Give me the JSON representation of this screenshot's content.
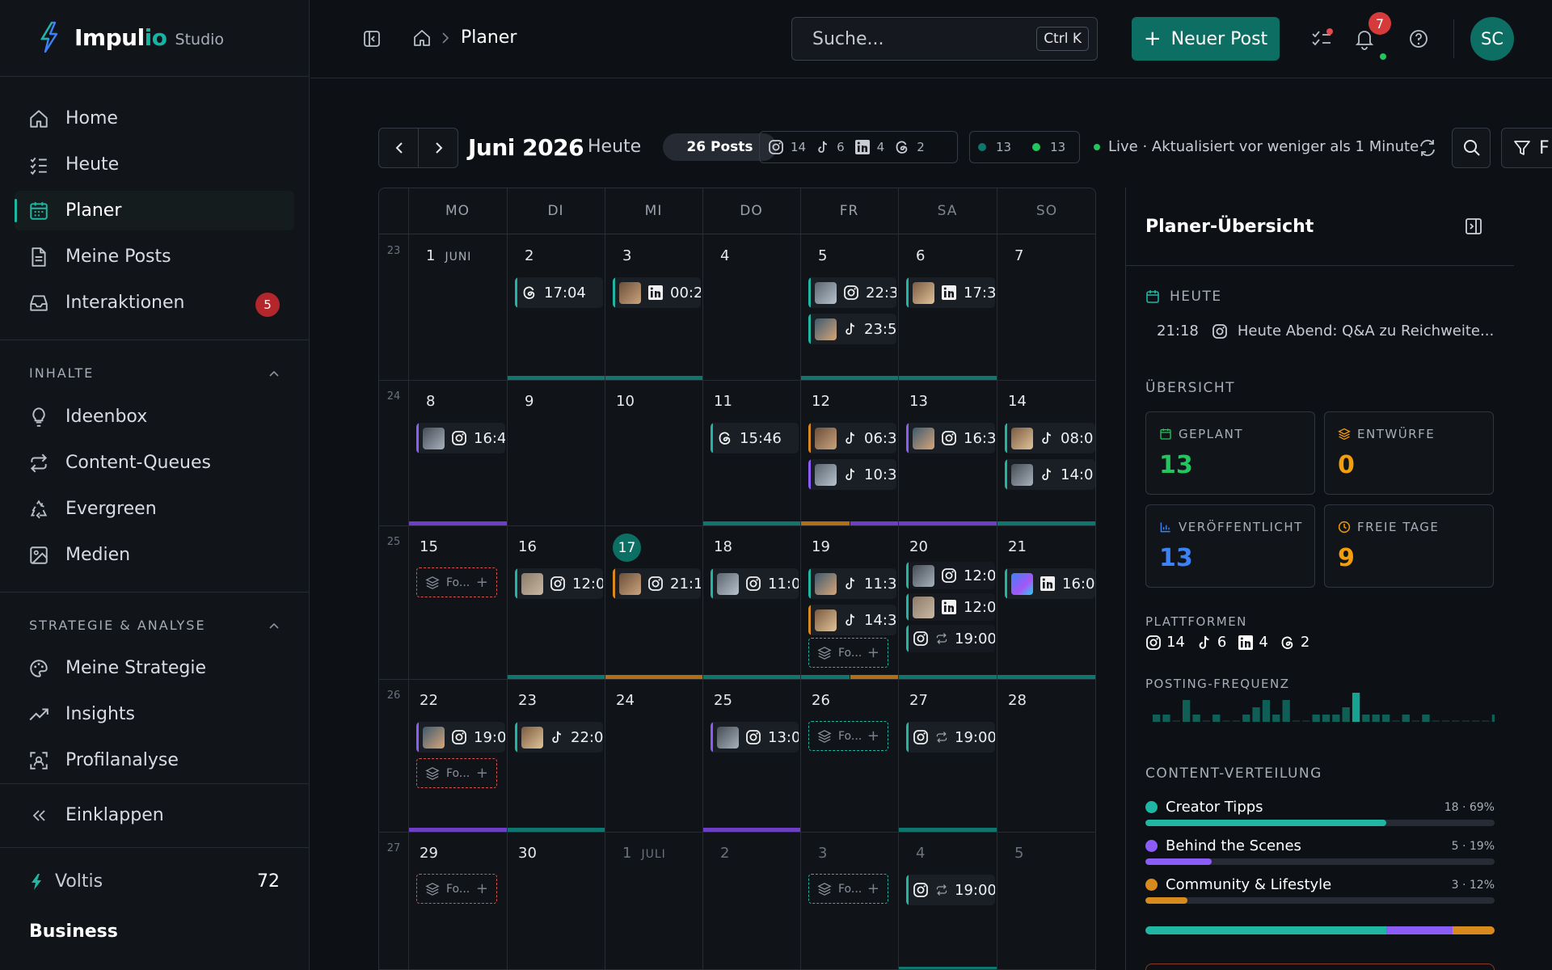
{
  "brand": {
    "name": "Impul",
    "name_accent": "io",
    "sub": "Studio"
  },
  "nav": {
    "items": [
      {
        "label": "Home",
        "icon": "home-icon"
      },
      {
        "label": "Heute",
        "icon": "checklist-icon"
      },
      {
        "label": "Planer",
        "icon": "calendar-icon",
        "active": true
      },
      {
        "label": "Meine Posts",
        "icon": "document-icon"
      },
      {
        "label": "Interaktionen",
        "icon": "inbox-icon",
        "badge": "5"
      }
    ],
    "section_content": "INHALTE",
    "content_items": [
      {
        "label": "Ideenbox",
        "icon": "lightbulb-icon"
      },
      {
        "label": "Content-Queues",
        "icon": "repeat-icon"
      },
      {
        "label": "Evergreen",
        "icon": "recycle-icon"
      },
      {
        "label": "Medien",
        "icon": "image-icon"
      }
    ],
    "section_strategy": "STRATEGIE & ANALYSE",
    "strategy_items": [
      {
        "label": "Meine Strategie",
        "icon": "palette-icon"
      },
      {
        "label": "Insights",
        "icon": "trend-icon"
      },
      {
        "label": "Profilanalyse",
        "icon": "scan-icon"
      }
    ],
    "collapse": "Einklappen",
    "voltis_label": "Voltis",
    "voltis_value": "72",
    "plan": "Business"
  },
  "topbar": {
    "breadcrumb": "Planer",
    "search_placeholder": "Suche...",
    "shortcut": "Ctrl K",
    "new_post": "Neuer Post",
    "notifications": "7",
    "avatar": "SC"
  },
  "toolbar": {
    "month": "Juni 2026",
    "today": "Heute",
    "posts": "26 Posts",
    "platform_counts": {
      "instagram": "14",
      "tiktok": "6",
      "linkedin": "4",
      "threads": "2"
    },
    "status_counts": {
      "scheduled": "13",
      "published": "13"
    },
    "live": "Live · Aktualisiert vor weniger als 1 Minute",
    "filter": "F"
  },
  "calendar": {
    "weekdays": [
      "MO",
      "DI",
      "MI",
      "DO",
      "FR",
      "SA",
      "SO"
    ],
    "week_numbers": [
      "23",
      "24",
      "25",
      "26",
      "27"
    ],
    "month_label_jun": "JUNI",
    "month_label_jul": "JULI",
    "today": "17",
    "days": [
      [
        "1",
        "2",
        "3",
        "4",
        "5",
        "6",
        "7"
      ],
      [
        "8",
        "9",
        "10",
        "11",
        "12",
        "13",
        "14"
      ],
      [
        "15",
        "16",
        "17",
        "18",
        "19",
        "20",
        "21"
      ],
      [
        "22",
        "23",
        "24",
        "25",
        "26",
        "27",
        "28"
      ],
      [
        "29",
        "30",
        "1",
        "2",
        "3",
        "4",
        "5"
      ]
    ],
    "posts": [
      {
        "w": 0,
        "d": 1,
        "slot": 0,
        "platform": "threads",
        "time": "17:04",
        "thumb": false,
        "bar": "#1fb6a4"
      },
      {
        "w": 0,
        "d": 2,
        "slot": 0,
        "platform": "linkedin",
        "time": "00:2",
        "thumb": true,
        "bar": "#1fb6a4"
      },
      {
        "w": 0,
        "d": 4,
        "slot": 0,
        "platform": "instagram",
        "time": "22:3",
        "thumb": true,
        "bar": "#1fb6a4"
      },
      {
        "w": 0,
        "d": 4,
        "slot": 1,
        "platform": "tiktok",
        "time": "23:5",
        "thumb": true,
        "bar": "#1fb6a4"
      },
      {
        "w": 0,
        "d": 5,
        "slot": 0,
        "platform": "linkedin",
        "time": "17:3",
        "thumb": true,
        "bar": "#1fb6a4"
      },
      {
        "w": 1,
        "d": 0,
        "slot": 0,
        "platform": "instagram",
        "time": "16:4",
        "thumb": true,
        "bar": "#8b5cf6"
      },
      {
        "w": 1,
        "d": 3,
        "slot": 0,
        "platform": "threads",
        "time": "15:46",
        "thumb": false,
        "bar": "#1fb6a4"
      },
      {
        "w": 1,
        "d": 4,
        "slot": 0,
        "platform": "tiktok",
        "time": "06:3",
        "thumb": true,
        "bar": "#d98a1e"
      },
      {
        "w": 1,
        "d": 4,
        "slot": 1,
        "platform": "tiktok",
        "time": "10:3",
        "thumb": true,
        "bar": "#8b5cf6"
      },
      {
        "w": 1,
        "d": 5,
        "slot": 0,
        "platform": "instagram",
        "time": "16:3",
        "thumb": true,
        "bar": "#8b5cf6"
      },
      {
        "w": 1,
        "d": 6,
        "slot": 0,
        "platform": "tiktok",
        "time": "08:0",
        "thumb": true,
        "bar": "#1fb6a4"
      },
      {
        "w": 1,
        "d": 6,
        "slot": 1,
        "platform": "tiktok",
        "time": "14:0",
        "thumb": true,
        "bar": "#1fb6a4"
      },
      {
        "w": 2,
        "d": 1,
        "slot": 0,
        "platform": "instagram",
        "time": "12:0",
        "thumb": true,
        "bar": "#1fb6a4"
      },
      {
        "w": 2,
        "d": 2,
        "slot": 0,
        "platform": "instagram",
        "time": "21:1",
        "thumb": true,
        "bar": "#d98a1e"
      },
      {
        "w": 2,
        "d": 3,
        "slot": 0,
        "platform": "instagram",
        "time": "11:0",
        "thumb": true,
        "bar": "#1fb6a4"
      },
      {
        "w": 2,
        "d": 4,
        "slot": 0,
        "platform": "tiktok",
        "time": "11:3",
        "thumb": true,
        "bar": "#1fb6a4"
      },
      {
        "w": 2,
        "d": 4,
        "slot": 1,
        "platform": "tiktok",
        "time": "14:3",
        "thumb": true,
        "bar": "#d98a1e"
      },
      {
        "w": 2,
        "d": 5,
        "slot": 0,
        "platform": "instagram",
        "time": "12:0",
        "thumb": true,
        "bar": "#1fb6a4",
        "compact": true
      },
      {
        "w": 2,
        "d": 5,
        "slot": 1,
        "platform": "linkedin",
        "time": "12:0",
        "thumb": true,
        "bar": "#1fb6a4",
        "compact": true
      },
      {
        "w": 2,
        "d": 5,
        "slot": 2,
        "platform": "instagram",
        "time": "19:00",
        "thumb": false,
        "repeat": true,
        "bar": "#1fb6a4",
        "compact": true
      },
      {
        "w": 2,
        "d": 6,
        "slot": 0,
        "platform": "linkedin",
        "time": "16:0",
        "thumb": true,
        "bar": "#1fb6a4",
        "thumbColor": "blue"
      },
      {
        "w": 3,
        "d": 0,
        "slot": 0,
        "platform": "instagram",
        "time": "19:0",
        "thumb": true,
        "bar": "#8b5cf6"
      },
      {
        "w": 3,
        "d": 1,
        "slot": 0,
        "platform": "tiktok",
        "time": "22:0",
        "thumb": true,
        "bar": "#1fb6a4"
      },
      {
        "w": 3,
        "d": 3,
        "slot": 0,
        "platform": "instagram",
        "time": "13:0",
        "thumb": true,
        "bar": "#8b5cf6"
      },
      {
        "w": 3,
        "d": 5,
        "slot": 0,
        "platform": "instagram",
        "time": "19:00",
        "thumb": false,
        "repeat": true,
        "bar": "#1fb6a4"
      },
      {
        "w": 4,
        "d": 5,
        "slot": 0,
        "platform": "instagram",
        "time": "19:00",
        "thumb": false,
        "repeat": true,
        "bar": "#1fb6a4"
      }
    ],
    "placeholders": [
      {
        "w": 2,
        "d": 0,
        "slot": 0,
        "label": "Fo...",
        "color": "#d9534f"
      },
      {
        "w": 2,
        "d": 4,
        "slot": 2,
        "label": "Fo...",
        "color": "#1fb6a4"
      },
      {
        "w": 3,
        "d": 0,
        "slot": 1,
        "label": "Fo...",
        "color": "#d9534f"
      },
      {
        "w": 3,
        "d": 4,
        "slot": 0,
        "label": "Fo...",
        "color": "#1fb6a4"
      },
      {
        "w": 4,
        "d": 0,
        "slot": 0,
        "label": "Fo...",
        "color": "#d9534f"
      },
      {
        "w": 4,
        "d": 4,
        "slot": 0,
        "label": "Fo...",
        "color": "#1fb6a4"
      }
    ],
    "day_bars": [
      {
        "w": 0,
        "d": 1,
        "segs": [
          "#0f766e"
        ]
      },
      {
        "w": 0,
        "d": 2,
        "segs": [
          "#0f766e"
        ]
      },
      {
        "w": 0,
        "d": 4,
        "segs": [
          "#0f766e"
        ]
      },
      {
        "w": 0,
        "d": 5,
        "segs": [
          "#0f766e"
        ]
      },
      {
        "w": 1,
        "d": 0,
        "segs": [
          "#6d3fc4"
        ]
      },
      {
        "w": 1,
        "d": 3,
        "segs": [
          "#0f766e"
        ]
      },
      {
        "w": 1,
        "d": 4,
        "segs": [
          "#b06f16",
          "#6d3fc4"
        ]
      },
      {
        "w": 1,
        "d": 5,
        "segs": [
          "#6d3fc4"
        ]
      },
      {
        "w": 1,
        "d": 6,
        "segs": [
          "#0f766e"
        ]
      },
      {
        "w": 2,
        "d": 1,
        "segs": [
          "#0f766e"
        ]
      },
      {
        "w": 2,
        "d": 2,
        "segs": [
          "#b06f16"
        ]
      },
      {
        "w": 2,
        "d": 3,
        "segs": [
          "#0f766e"
        ]
      },
      {
        "w": 2,
        "d": 4,
        "segs": [
          "#0f766e",
          "#b06f16"
        ]
      },
      {
        "w": 2,
        "d": 5,
        "segs": [
          "#0f766e"
        ]
      },
      {
        "w": 2,
        "d": 6,
        "segs": [
          "#0f766e"
        ]
      },
      {
        "w": 3,
        "d": 0,
        "segs": [
          "#6d3fc4"
        ]
      },
      {
        "w": 3,
        "d": 1,
        "segs": [
          "#0f766e"
        ]
      },
      {
        "w": 3,
        "d": 3,
        "segs": [
          "#6d3fc4"
        ]
      },
      {
        "w": 3,
        "d": 5,
        "segs": [
          "#0f766e"
        ]
      },
      {
        "w": 4,
        "d": 5,
        "segs": [
          "#0f766e"
        ]
      }
    ]
  },
  "panel": {
    "title": "Planer-Übersicht",
    "today_label": "HEUTE",
    "today_time": "21:18",
    "today_text": "Heute Abend: Q&A zu Reichweite...",
    "overview_label": "ÜBERSICHT",
    "kpis": [
      {
        "label": "GEPLANT",
        "value": "13",
        "color": "#22c55e",
        "icon": "calendar-icon"
      },
      {
        "label": "ENTWÜRFE",
        "value": "0",
        "color": "#f59e0b",
        "icon": "layers-icon"
      },
      {
        "label": "VERÖFFENTLICHT",
        "value": "13",
        "color": "#3b82f6",
        "icon": "chart-icon"
      },
      {
        "label": "FREIE TAGE",
        "value": "9",
        "color": "#f59e0b",
        "icon": "clock-icon"
      }
    ],
    "platforms_label": "PLATTFORMEN",
    "platforms": [
      {
        "icon": "instagram",
        "count": "14"
      },
      {
        "icon": "tiktok",
        "count": "6"
      },
      {
        "icon": "linkedin",
        "count": "4"
      },
      {
        "icon": "threads",
        "count": "2"
      }
    ],
    "frequency_label": "POSTING-FREQUENZ",
    "frequency": [
      1,
      1,
      0,
      3,
      1,
      0,
      1,
      0,
      0,
      1,
      2,
      3,
      1,
      3,
      0,
      0,
      1,
      1,
      1,
      2,
      4,
      1,
      1,
      1,
      0,
      1,
      0,
      1,
      0,
      0,
      0,
      0,
      0,
      0,
      1
    ],
    "distribution_label": "CONTENT-VERTEILUNG",
    "distribution": [
      {
        "name": "Creator Tipps",
        "pct": "18 · 69%",
        "frac": 0.69,
        "color": "#1fb6a4"
      },
      {
        "name": "Behind the Scenes",
        "pct": "5 · 19%",
        "frac": 0.19,
        "color": "#8b5cf6"
      },
      {
        "name": "Community & Lifestyle",
        "pct": "3 · 12%",
        "frac": 0.12,
        "color": "#d98a1e"
      }
    ]
  }
}
